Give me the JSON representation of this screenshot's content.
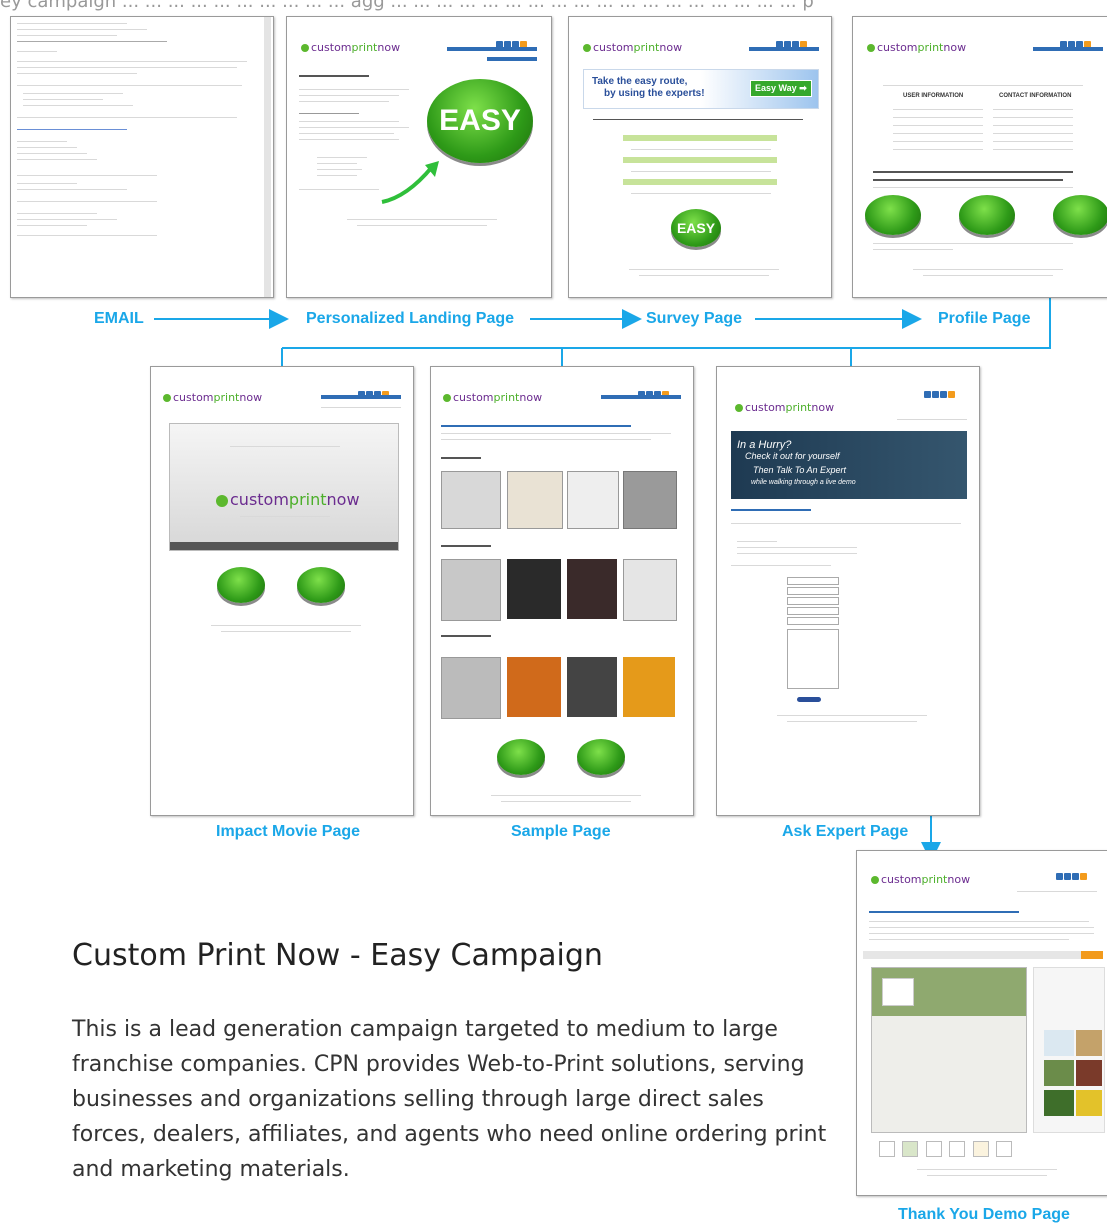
{
  "top_text": "ey campaign ... ... ... ... ... ... ... ... ... ... agg ... ... ... ... ... ... ... ... ... ... ... ... ... ... ... ... ... ... p",
  "flow": {
    "row1_labels": [
      "EMAIL",
      "Personalized Landing Page",
      "Survey Page",
      "Profile Page"
    ],
    "row2_labels": [
      "Impact Movie Page",
      "Sample Page",
      "Ask Expert Page"
    ],
    "final_label": "Thank You Demo Page"
  },
  "brand": {
    "logo_text_a": "custom",
    "logo_text_b": "print",
    "logo_text_c": "now",
    "accent_color": "#1aa7e8",
    "button_color": "#3fb21c"
  },
  "landing": {
    "button_text": "EASY"
  },
  "survey": {
    "banner_line1": "Take the easy route,",
    "banner_line2": "by using the experts!",
    "banner_button": "Easy Way ➡",
    "button_text": "EASY"
  },
  "profile": {
    "header_left": "USER INFORMATION",
    "header_right": "CONTACT INFORMATION"
  },
  "expert": {
    "banner_line1": "In a Hurry?",
    "banner_line2": "Check it out for yourself",
    "banner_line3": "Then Talk To An Expert",
    "banner_line4": "while walking through a live demo"
  },
  "heading": "Custom Print Now - Easy Campaign",
  "description": "This is a lead generation campaign targeted to medium to large franchise companies. CPN provides Web-to-Print solutions, serving businesses and organizations selling through large direct sales forces, dealers, affiliates, and agents who need online ordering print and marketing materials."
}
